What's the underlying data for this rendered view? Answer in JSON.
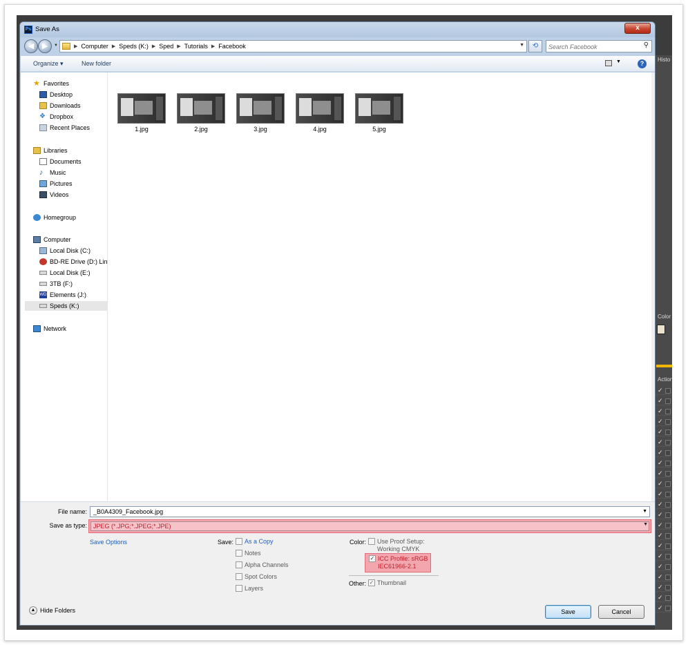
{
  "window": {
    "title": "Save As",
    "app_icon": "Ps",
    "close_label": "x"
  },
  "nav": {
    "back_icon": "back-arrow-icon",
    "forward_icon": "forward-arrow-icon",
    "breadcrumbs": [
      "Computer",
      "Speds (K:)",
      "Sped",
      "Tutorials",
      "Facebook"
    ],
    "search_placeholder": "Search Facebook"
  },
  "toolbar": {
    "organize_label": "Organize ▾",
    "new_folder_label": "New folder"
  },
  "sidebar": {
    "favorites": {
      "label": "Favorites",
      "items": [
        "Desktop",
        "Downloads",
        "Dropbox",
        "Recent Places"
      ]
    },
    "libraries": {
      "label": "Libraries",
      "items": [
        "Documents",
        "Music",
        "Pictures",
        "Videos"
      ]
    },
    "homegroup": "Homegroup",
    "computer": {
      "label": "Computer",
      "items": [
        "Local Disk (C:)",
        "BD-RE Drive (D:) Linl",
        "Local Disk (E:)",
        "3TB (F:)",
        "Elements (J:)",
        "Speds (K:)"
      ],
      "selected": "Speds (K:)"
    },
    "network": "Network"
  },
  "files": [
    "1.jpg",
    "2.jpg",
    "3.jpg",
    "4.jpg",
    "5.jpg"
  ],
  "form": {
    "file_name_label": "File name:",
    "file_name_value": "_B0A4309_Facebook.jpg",
    "save_as_type_label": "Save as type:",
    "save_as_type_value": "JPEG (*.JPG;*.JPEG;*.JPE)",
    "save_options_link": "Save Options"
  },
  "save_options": {
    "label": "Save:",
    "as_copy": "As a Copy",
    "notes": "Notes",
    "alpha_channels": "Alpha Channels",
    "spot_colors": "Spot Colors",
    "layers": "Layers"
  },
  "color_options": {
    "label": "Color:",
    "use_proof_line1": "Use Proof Setup:",
    "use_proof_line2": "Working CMYK",
    "icc_line1": "ICC Profile:  sRGB",
    "icc_line2": "IEC61966-2.1",
    "icc_checked": true
  },
  "other_options": {
    "label": "Other:",
    "thumbnail": "Thumbnail",
    "thumbnail_checked": true
  },
  "buttons": {
    "save": "Save",
    "cancel": "Cancel",
    "hide_folders": "Hide Folders"
  },
  "photoshop_panels": {
    "history": "Histo",
    "color": "Color",
    "actions": "Action"
  }
}
